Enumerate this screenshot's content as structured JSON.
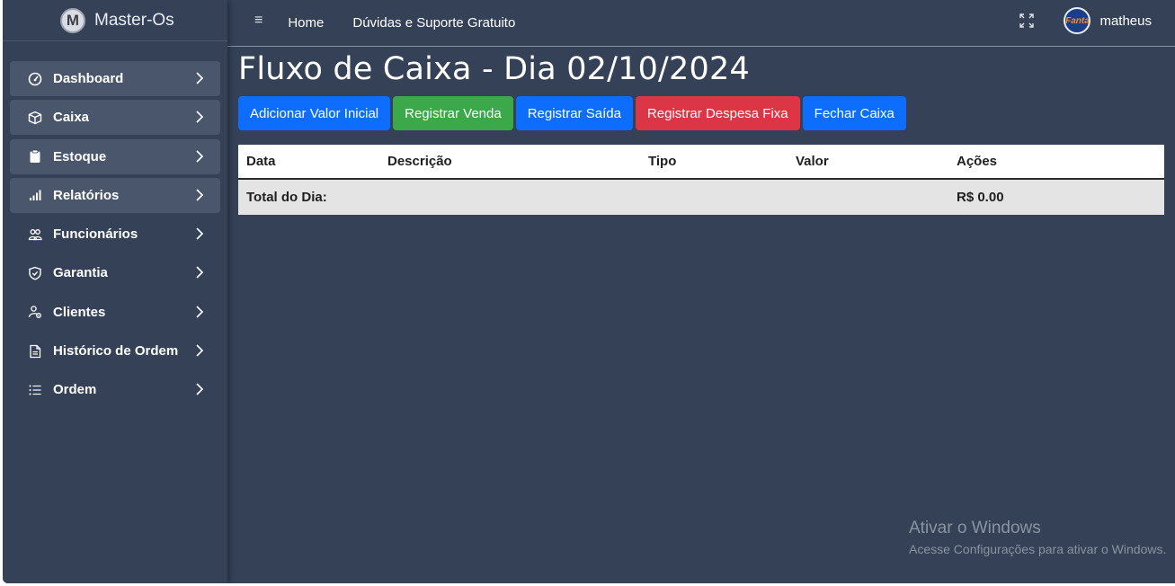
{
  "brand": {
    "logo_letter": "M",
    "name": "Master-Os"
  },
  "sidebar": {
    "items": [
      {
        "label": "Dashboard",
        "icon": "gauge-icon",
        "active": true
      },
      {
        "label": "Caixa",
        "icon": "box-icon",
        "active": true
      },
      {
        "label": "Estoque",
        "icon": "clipboard-icon",
        "active": true
      },
      {
        "label": "Relatórios",
        "icon": "bar-chart-icon",
        "active": true
      },
      {
        "label": "Funcionários",
        "icon": "people-icon",
        "active": false
      },
      {
        "label": "Garantia",
        "icon": "shield-icon",
        "active": false
      },
      {
        "label": "Clientes",
        "icon": "user-gear-icon",
        "active": false
      },
      {
        "label": "Histórico de Ordem",
        "icon": "document-icon",
        "active": false
      },
      {
        "label": "Ordem",
        "icon": "list-icon",
        "active": false
      }
    ]
  },
  "topbar": {
    "menu_glyph": "≡",
    "nav": [
      "Home",
      "Dúvidas e Suporte Gratuito"
    ],
    "avatar_text": "Fanta",
    "username": "matheus"
  },
  "page": {
    "title": "Fluxo de Caixa - Dia 02/10/2024",
    "buttons": [
      {
        "label": "Adicionar Valor Inicial",
        "color": "#0d6efd"
      },
      {
        "label": "Registrar Venda",
        "color": "#3ba84a"
      },
      {
        "label": "Registrar Saída",
        "color": "#0d6efd"
      },
      {
        "label": "Registrar Despesa Fixa",
        "color": "#dc3545"
      },
      {
        "label": "Fechar Caixa",
        "color": "#0d6efd"
      }
    ]
  },
  "table": {
    "headers": [
      "Data",
      "Descrição",
      "Tipo",
      "Valor",
      "Ações"
    ],
    "total_label": "Total do Dia:",
    "total_value": "R$ 0.00"
  },
  "watermark": {
    "title": "Ativar o Windows",
    "subtitle": "Acesse Configurações para ativar o Windows."
  }
}
